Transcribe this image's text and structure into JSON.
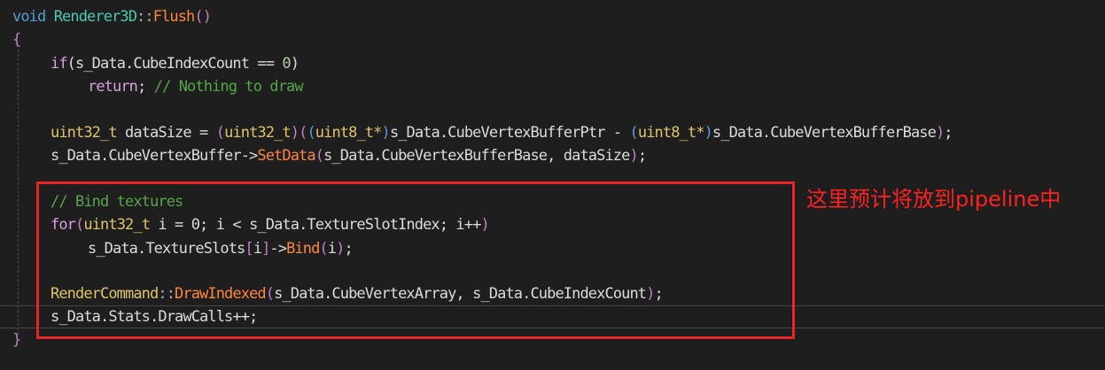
{
  "code": {
    "l1": {
      "kw": "void",
      "cls": "Renderer3D",
      "sep": "::",
      "fn": "Flush",
      "paren": "()"
    },
    "l2": {
      "brace": "{"
    },
    "l3": {
      "kw": "if",
      "open": "(",
      "expr": "s_Data.CubeIndexCount == ",
      "num": "0",
      "close": ")"
    },
    "l4": {
      "kw": "return",
      "semi": ";",
      "comment": "// Nothing to draw"
    },
    "l5": {
      "type1": "uint32_t",
      "var": " dataSize = ",
      "p1": "(",
      "type2": "uint32_t",
      "p2": ")",
      "p3": "(",
      "p4": "(",
      "type3": "uint8_t*",
      "p5": ")",
      "ptr": "s_Data.CubeVertexBufferPtr - ",
      "p6": "(",
      "type4": "uint8_t*",
      "p7": ")",
      "base": "s_Data.CubeVertexBufferBase",
      "p8": ")",
      "semi": ";"
    },
    "l6": {
      "obj": "s_Data.CubeVertexBuffer->",
      "fn": "SetData",
      "open": "(",
      "args": "s_Data.CubeVertexBufferBase, dataSize",
      "close": ")",
      "semi": ";"
    },
    "l7": {
      "comment": "// Bind textures"
    },
    "l8": {
      "kw": "for",
      "open": "(",
      "type": "uint32_t",
      "rest": " i = 0; i < s_Data.TextureSlotIndex; i++",
      "close": ")"
    },
    "l9": {
      "obj": "s_Data.TextureSlots",
      "b1": "[",
      "idx": "i",
      "b2": "]",
      "arrow": "->",
      "fn": "Bind",
      "open": "(",
      "arg": "i",
      "close": ")",
      "semi": ";"
    },
    "l10": {
      "cls": "RenderCommand",
      "sep": "::",
      "fn": "DrawIndexed",
      "open": "(",
      "args": "s_Data.CubeVertexArray, s_Data.CubeIndexCount",
      "close": ")",
      "semi": ";"
    },
    "l11": {
      "text": "s_Data.Stats.DrawCalls++;"
    },
    "l12": {
      "brace": "}"
    }
  },
  "annotation": {
    "text": "这里预计将放到pipeline中",
    "color": "#ff2020"
  },
  "colors": {
    "background": "#1e1e1e",
    "keyword": "#569cd6",
    "control_keyword": "#d8a0df",
    "type": "#4ec9b0",
    "function": "#ff8640",
    "comment": "#57a64a",
    "box": "#e8242a"
  }
}
